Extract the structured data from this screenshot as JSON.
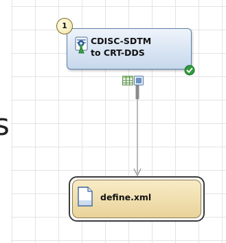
{
  "transform_node": {
    "step_number": "1",
    "title_line1": "CDISC-SDTM",
    "title_line2": "to CRT-DDS",
    "icon": "dataset-transform-icon",
    "status_icon": "check-circle-icon",
    "status_color": "#2e9b3a"
  },
  "ports": {
    "input_port_icon": "table-grid-icon",
    "output_port_icon": "output-port-icon"
  },
  "output_node": {
    "label": "define.xml",
    "icon": "document-icon"
  },
  "colors": {
    "transform_fill": "#c7d8ec",
    "transform_border": "#5d7fa8",
    "output_fill": "#e9d39a",
    "connector": "#888888"
  }
}
